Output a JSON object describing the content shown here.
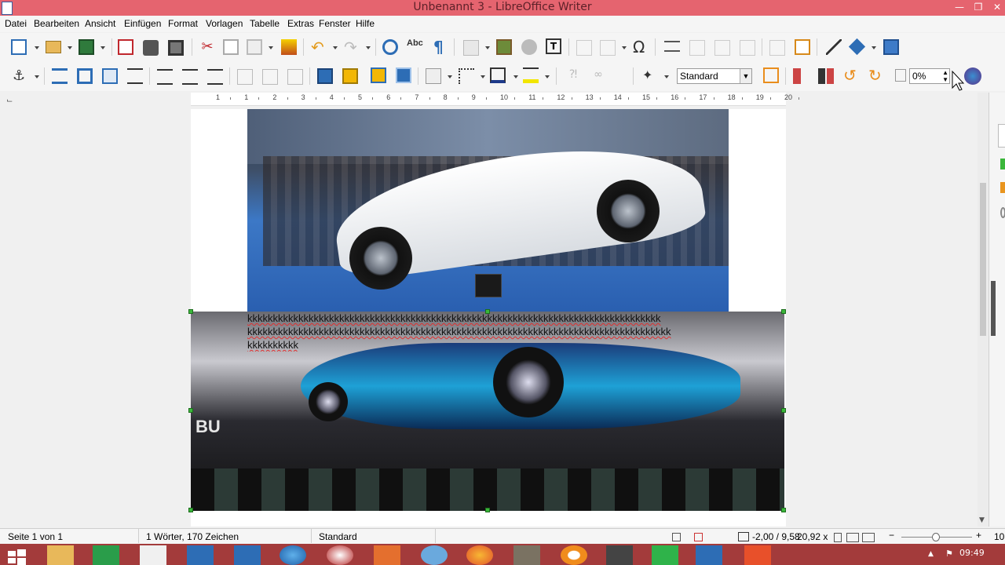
{
  "window": {
    "title": "Unbenannt 3 - LibreOffice Writer"
  },
  "menu": [
    "Datei",
    "Bearbeiten",
    "Ansicht",
    "Einfügen",
    "Format",
    "Vorlagen",
    "Tabelle",
    "Extras",
    "Fenster",
    "Hilfe"
  ],
  "toolbar2": {
    "frame_style": "Standard",
    "transparency": "0%"
  },
  "ruler": {
    "numbers": [
      "1",
      "1",
      "2",
      "3",
      "4",
      "5",
      "6",
      "7",
      "8",
      "9",
      "10",
      "11",
      "12",
      "13",
      "14",
      "15",
      "16",
      "17",
      "18",
      "19",
      "20"
    ]
  },
  "document": {
    "text_line1": "kkkkkkkkkkkkkkkkkkkkkkkkkkkkkkkkkkkkkkkkkkkkkkkkkkkkkkkkkkkkkkkkkkkkkkkkkkkkkkkkk",
    "text_line2": "kkkkkkkkkkkkkkkkkkkkkkkkkkkkkkkkkkkkkkkkkkkkkkkkkkkkkkkkkkkkkkkkkkkkkkkkkkkkkkkkkkk",
    "text_line3": "kkkkkkkkkk",
    "watermark_text": "BU"
  },
  "statusbar": {
    "page": "Seite 1 von 1",
    "words": "1 Wörter, 170 Zeichen",
    "style": "Standard",
    "position": "-2,00 / 9,58",
    "size": "20,92 x",
    "zoom": "10"
  },
  "taskbar": {
    "time": "09:49"
  },
  "colors": {
    "titlebar": "#e5646f",
    "taskbar": "#a33b3b",
    "font_color_bar": "#1e3a8a",
    "highlight_bar": "#f2e600"
  }
}
